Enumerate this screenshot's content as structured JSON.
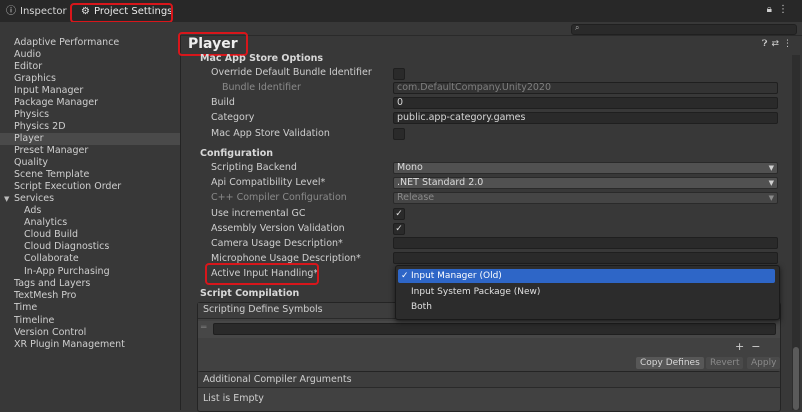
{
  "tabs": {
    "inspector": "Inspector",
    "project_settings": "Project Settings",
    "inspector_icon": "info-circle-icon",
    "project_settings_icon": "gear-icon"
  },
  "search": {
    "placeholder": "",
    "icon": "search-icon"
  },
  "sidebar": {
    "items": [
      {
        "label": "Adaptive Performance"
      },
      {
        "label": "Audio"
      },
      {
        "label": "Editor"
      },
      {
        "label": "Graphics"
      },
      {
        "label": "Input Manager"
      },
      {
        "label": "Package Manager"
      },
      {
        "label": "Physics"
      },
      {
        "label": "Physics 2D"
      },
      {
        "label": "Player",
        "selected": true
      },
      {
        "label": "Preset Manager"
      },
      {
        "label": "Quality"
      },
      {
        "label": "Scene Template"
      },
      {
        "label": "Script Execution Order"
      },
      {
        "label": "Services",
        "expanded": true
      },
      {
        "label": "Ads"
      },
      {
        "label": "Analytics"
      },
      {
        "label": "Cloud Build"
      },
      {
        "label": "Cloud Diagnostics"
      },
      {
        "label": "Collaborate"
      },
      {
        "label": "In-App Purchasing"
      },
      {
        "label": "Tags and Layers"
      },
      {
        "label": "TextMesh Pro"
      },
      {
        "label": "Time"
      },
      {
        "label": "Timeline"
      },
      {
        "label": "Version Control"
      },
      {
        "label": "XR Plugin Management"
      }
    ]
  },
  "main": {
    "title": "Player",
    "mac_app_store": {
      "header": "Mac App Store Options",
      "override_label": "Override Default Bundle Identifier",
      "bundle_id_label": "Bundle Identifier",
      "bundle_id_value": "com.DefaultCompany.Unity2020",
      "build_label": "Build",
      "build_value": "0",
      "category_label": "Category",
      "category_value": "public.app-category.games",
      "validation_label": "Mac App Store Validation"
    },
    "configuration": {
      "header": "Configuration",
      "scripting_backend_label": "Scripting Backend",
      "scripting_backend_value": "Mono",
      "api_label": "Api Compatibility Level*",
      "api_value": ".NET Standard 2.0",
      "cpp_label": "C++ Compiler Configuration",
      "cpp_value": "Release",
      "incremental_gc_label": "Use incremental GC",
      "incremental_gc_checked": true,
      "assembly_validation_label": "Assembly Version Validation",
      "assembly_validation_checked": true,
      "camera_usage_label": "Camera Usage Description*",
      "microphone_usage_label": "Microphone Usage Description*",
      "active_input_label": "Active Input Handling*"
    },
    "script_compilation": {
      "header": "Script Compilation",
      "defines_label": "Scripting Define Symbols",
      "copy_defines": "Copy Defines",
      "revert": "Revert",
      "apply": "Apply",
      "plus": "+",
      "minus": "−"
    },
    "compiler_args": {
      "header": "Additional Compiler Arguments",
      "empty_text": "List is Empty"
    }
  },
  "popup": {
    "options": [
      {
        "label": "Input Manager (Old)",
        "selected": true
      },
      {
        "label": "Input System Package (New)"
      },
      {
        "label": "Both"
      }
    ]
  },
  "colors": {
    "highlight": "#2e66c7",
    "annotation_red": "#d8161b",
    "background": "#383838"
  }
}
